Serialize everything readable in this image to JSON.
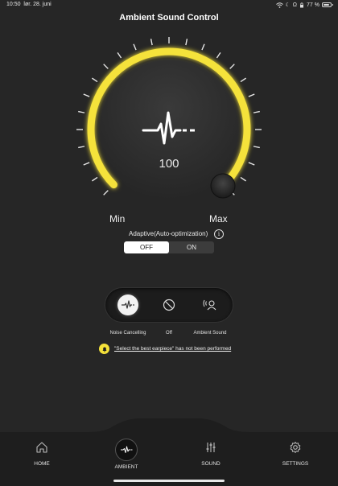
{
  "status": {
    "time": "10:50",
    "date": "lør. 28. juni",
    "battery": "77 %"
  },
  "title": "Ambient Sound Control",
  "dial": {
    "value": "100",
    "min_label": "Min",
    "max_label": "Max",
    "level_fraction": 1.0
  },
  "adaptive": {
    "label": "Adaptive(Auto-optimization)",
    "info": "i",
    "off_label": "OFF",
    "on_label": "ON",
    "selected": "OFF"
  },
  "modes": [
    {
      "label": "Noise Cancelling",
      "icon": "waveform-icon",
      "selected": true
    },
    {
      "label": "Off",
      "icon": "prohibited-icon",
      "selected": false
    },
    {
      "label": "Ambient Sound",
      "icon": "ambient-person-icon",
      "selected": false
    }
  ],
  "notice": {
    "text": "\"Select the best earpiece\" has not been performed",
    "icon": "bell-icon"
  },
  "nav": [
    {
      "label": "HOME",
      "icon": "home-icon"
    },
    {
      "label": "AMBIENT",
      "icon": "waveform-icon"
    },
    {
      "label": "SOUND",
      "icon": "equalizer-icon"
    },
    {
      "label": "SETTINGS",
      "icon": "gear-icon"
    }
  ],
  "colors": {
    "accent": "#f5e23a",
    "background": "#262626",
    "nav_background": "#1e1e1e"
  }
}
